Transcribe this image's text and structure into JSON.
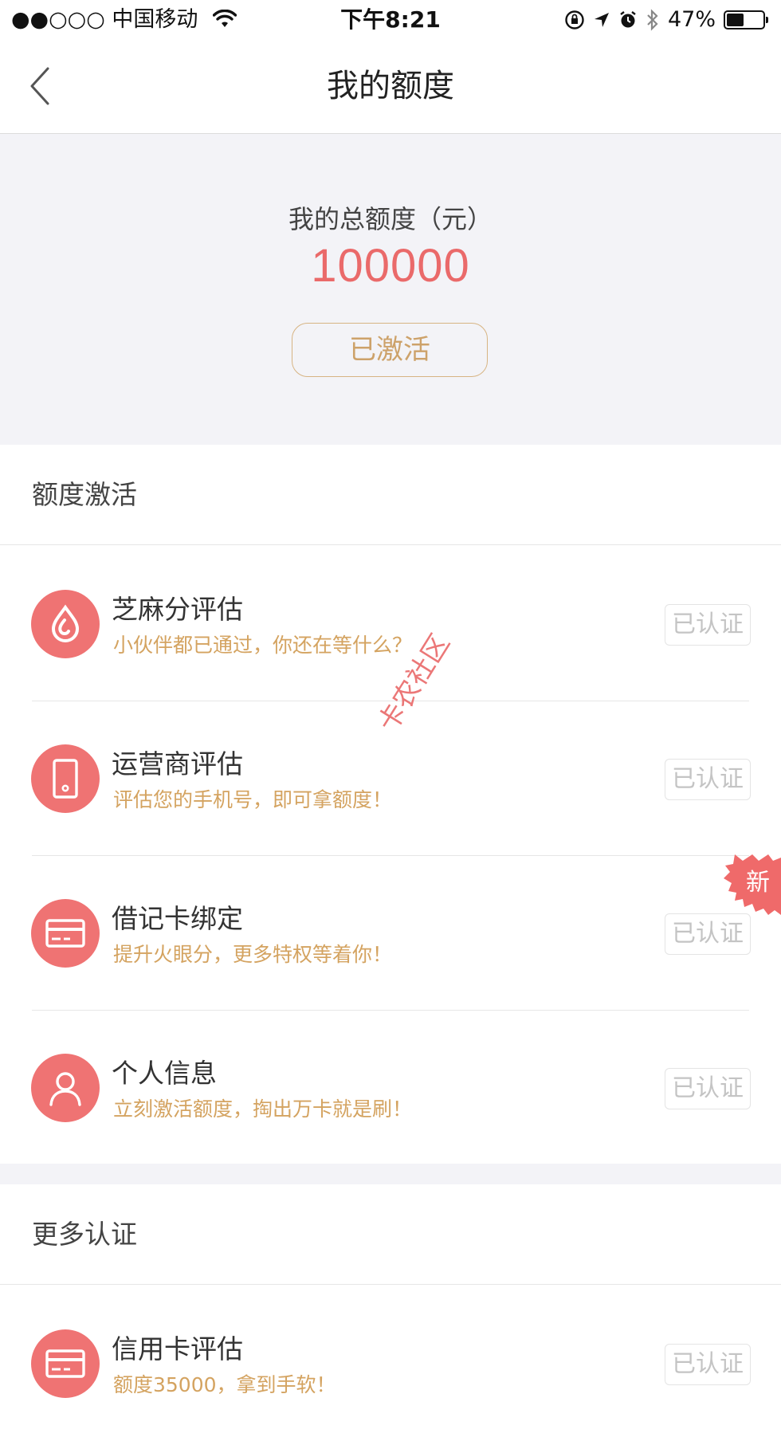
{
  "status_bar": {
    "carrier": "●●○○○ 中国移动",
    "time": "下午8:21",
    "battery": "47%",
    "battery_level": 0.47
  },
  "nav": {
    "title": "我的额度",
    "back_icon": "chevron-left-icon"
  },
  "summary": {
    "label": "我的总额度（元）",
    "amount": "100000",
    "status_button": "已激活"
  },
  "sections": [
    {
      "title": "额度激活",
      "items": [
        {
          "title": "芝麻分评估",
          "subtitle": "小伙伴都已通过，你还在等什么？",
          "status": "已认证",
          "icon": "sesame-drop-icon"
        },
        {
          "title": "运营商评估",
          "subtitle": "评估您的手机号，即可拿额度！",
          "status": "已认证",
          "icon": "phone-icon"
        },
        {
          "title": "借记卡绑定",
          "subtitle": "提升火眼分，更多特权等着你！",
          "status": "已认证",
          "icon": "bank-card-icon",
          "tag": "新"
        },
        {
          "title": "个人信息",
          "subtitle": "立刻激活额度，掏出万卡就是刷！",
          "status": "已认证",
          "icon": "person-icon"
        }
      ]
    },
    {
      "title": "更多认证",
      "items": [
        {
          "title": "信用卡评估",
          "subtitle": "额度35000，拿到手软！",
          "status": "已认证",
          "icon": "credit-card-icon"
        }
      ]
    }
  ],
  "watermark": {
    "text": "卡农社区"
  },
  "colors": {
    "accent_red": "#ef7373",
    "amount_red": "#ea6a6a",
    "gold": "#d4a360",
    "band_gray": "#f3f3f7"
  }
}
